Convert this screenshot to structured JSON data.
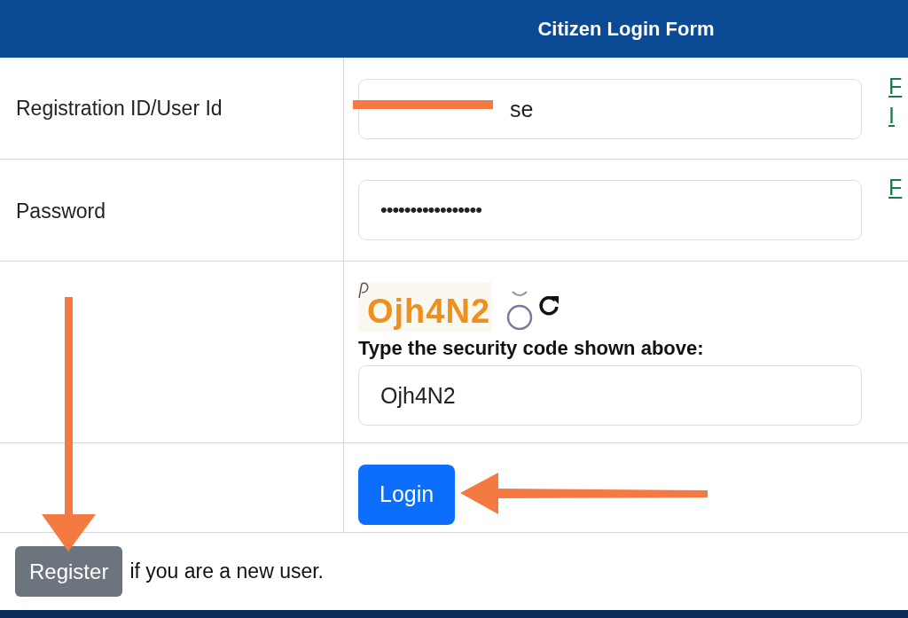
{
  "header": {
    "title": "Citizen Login Form"
  },
  "rows": [
    {
      "kind": "text",
      "label": "Registration ID/User Id",
      "value": "se",
      "links": [
        "F",
        "I"
      ]
    },
    {
      "kind": "password",
      "label": "Password",
      "value": "•••••••••••••••••",
      "links": [
        "F"
      ]
    },
    {
      "kind": "captcha",
      "captcha": "Ojh4N2",
      "prompt": "Type the security code shown above:",
      "value": "Ojh4N2"
    },
    {
      "kind": "submit",
      "button": "Login"
    }
  ],
  "footer": {
    "button": "Register",
    "text": "if you are a new user."
  }
}
